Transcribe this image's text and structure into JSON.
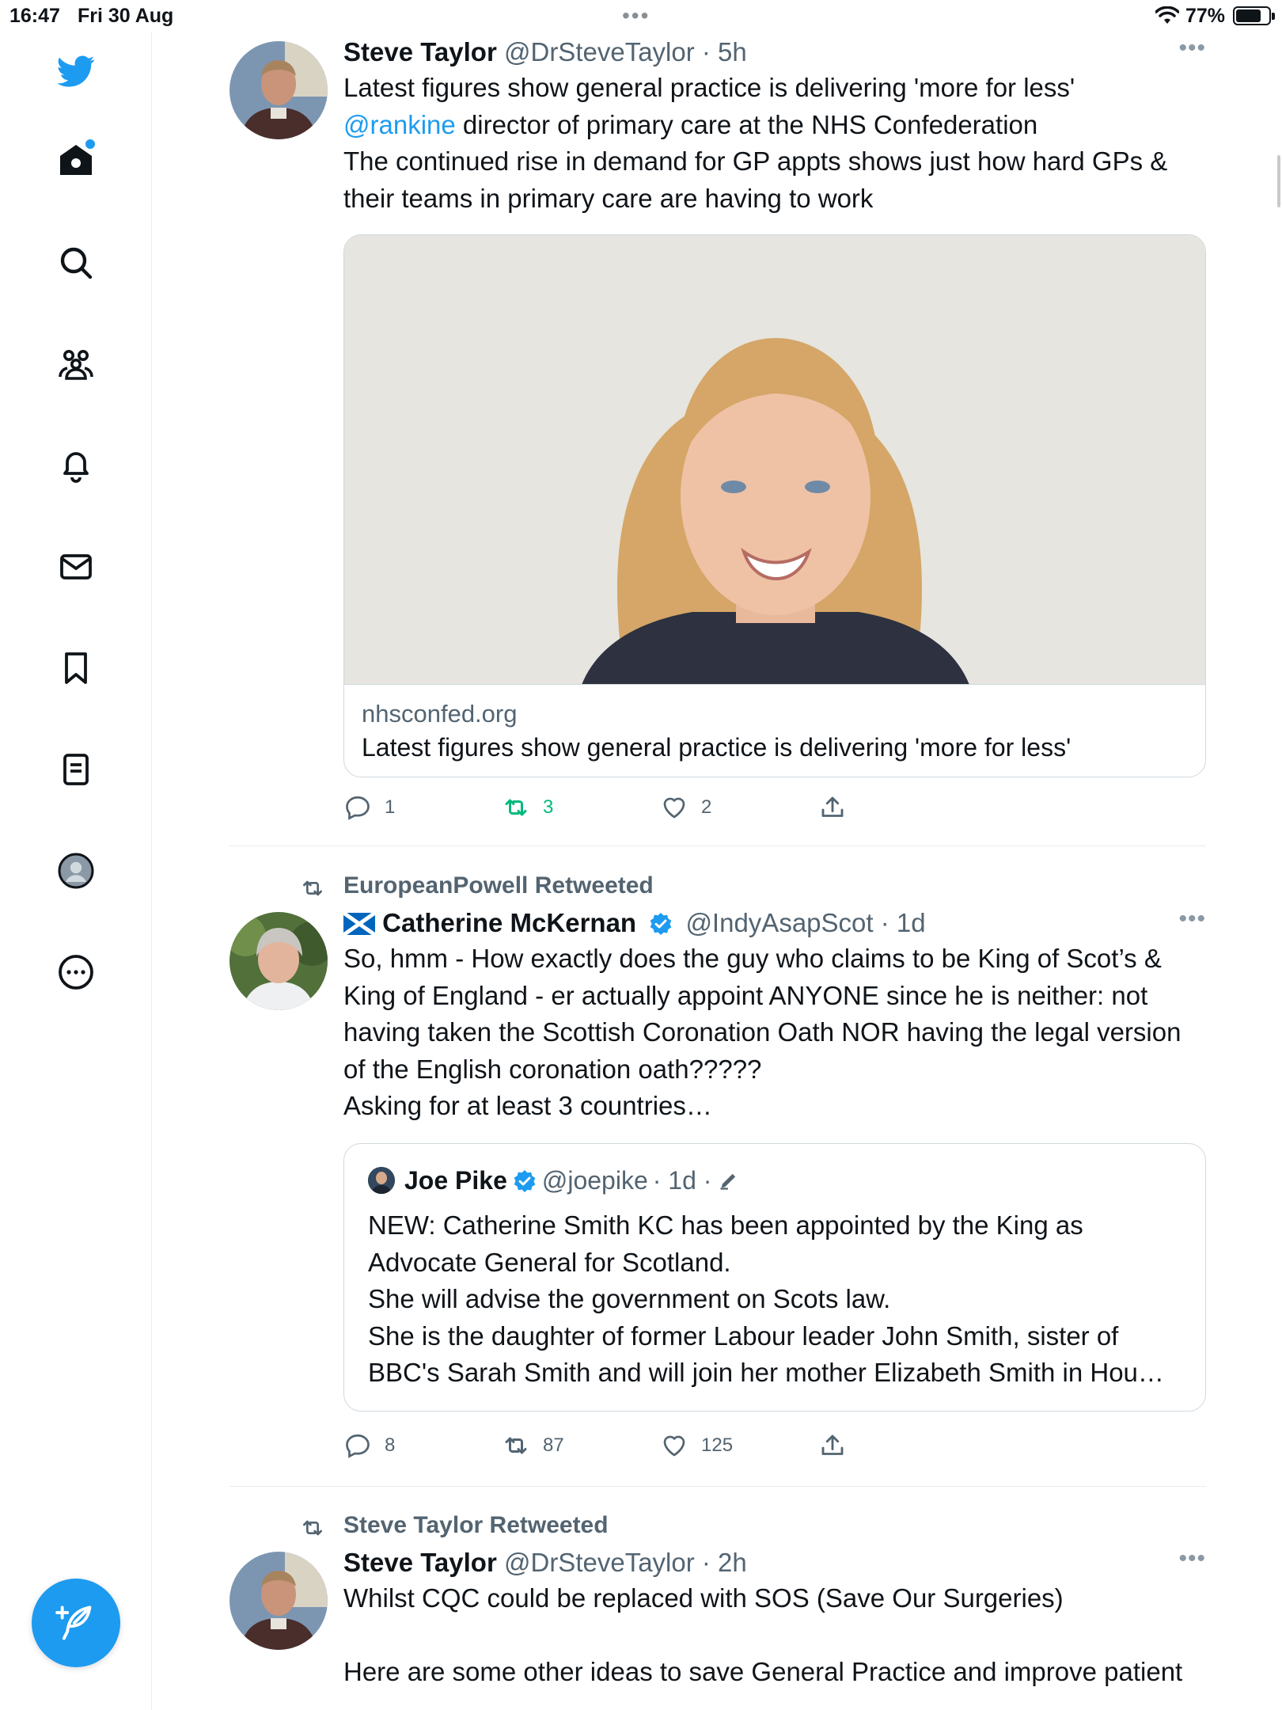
{
  "status_bar": {
    "time": "16:47",
    "date": "Fri 30 Aug",
    "dots": "•••",
    "battery": "77%"
  },
  "tweets": [
    {
      "name": "Steve Taylor",
      "handle": "@DrSteveTaylor",
      "time": "· 5h",
      "more": "•••",
      "text_line1": "Latest figures show general practice is delivering 'more for less'",
      "mention": "@rankine",
      "text_line2": " director of primary care at the NHS Confederation",
      "text_line3": "The continued rise in demand for GP appts shows just how hard GPs & their teams in primary care are having to work",
      "card": {
        "domain": "nhsconfed.org",
        "title": "Latest figures show general practice is delivering 'more for less'"
      },
      "replies": "1",
      "retweets": "3",
      "likes": "2"
    },
    {
      "retweeted_by": "EuropeanPowell Retweeted",
      "flag": "🏴󠁧󠁢󠁳󠁣󠁴󠁿",
      "name": "Catherine McKernan",
      "handle": "@IndyAsapScot",
      "time": "· 1d",
      "more": "•••",
      "text": "So, hmm - How exactly does the guy who claims to be King of Scot’s & King of England - er actually appoint ANYONE since he is neither: not having taken the Scottish Coronation Oath NOR having the legal version of the English coronation oath?????\nAsking for at least 3 countries…",
      "quote": {
        "name": "Joe Pike",
        "handle": "@joepike",
        "time": "· 1d ·",
        "text": "NEW: Catherine Smith KC has been appointed by the King as Advocate General for Scotland.\nShe will advise the government on Scots law.\nShe is the daughter of former Labour leader John Smith, sister of BBC's Sarah Smith and will join her mother Elizabeth Smith in Hou…"
      },
      "replies": "8",
      "retweets": "87",
      "likes": "125"
    },
    {
      "retweeted_by": "Steve Taylor Retweeted",
      "name": "Steve Taylor",
      "handle": "@DrSteveTaylor",
      "time": "· 2h",
      "more": "•••",
      "text_line1": "Whilst CQC could be replaced with SOS (Save Our Surgeries)",
      "text_line2": "Here are some other ideas to save General Practice and improve patient"
    }
  ],
  "colors": {
    "accent": "#1d9bf0",
    "retweet_active": "#00ba7c",
    "secondary_text": "#536471"
  },
  "icons": [
    "twitter-logo-icon",
    "home-icon",
    "search-icon",
    "communities-icon",
    "notifications-icon",
    "messages-icon",
    "bookmarks-icon",
    "lists-icon",
    "profile-icon",
    "more-icon",
    "compose-icon",
    "reply-icon",
    "retweet-icon",
    "like-icon",
    "share-icon",
    "verified-icon",
    "edit-icon",
    "wifi-icon",
    "battery-icon"
  ]
}
